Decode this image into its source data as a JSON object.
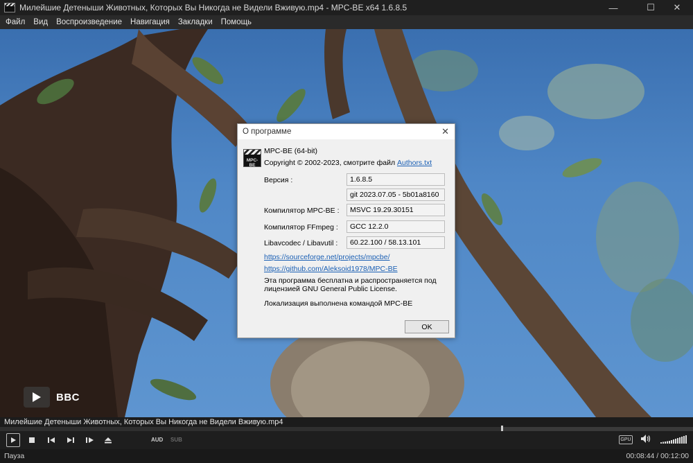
{
  "window": {
    "title": "Милейшие Детеныши Животных, Которых Вы Никогда не Видели Вживую.mp4 - MPC-BE x64 1.6.8.5",
    "min_glyph": "—",
    "max_glyph": "☐",
    "close_glyph": "✕"
  },
  "menu": [
    "Файл",
    "Вид",
    "Воспроизведение",
    "Навигация",
    "Закладки",
    "Помощь"
  ],
  "video": {
    "watermark": "BBC"
  },
  "about_dialog": {
    "title": "О программе",
    "close_glyph": "✕",
    "logo_text": "MPC-BE",
    "app_name": "MPC-BE (64-bit)",
    "copyright_prefix": "Copyright © 2002-2023, смотрите файл",
    "copyright_link": "Authors.txt",
    "rows": [
      {
        "label": "Версия :",
        "value": "1.6.8.5"
      },
      {
        "label": "",
        "value": "git 2023.07.05 - 5b01a8160"
      },
      {
        "label": "Компилятор MPC-BE :",
        "value": "MSVC 19.29.30151"
      },
      {
        "label": "Компилятор FFmpeg :",
        "value": "GCC 12.2.0"
      },
      {
        "label": "Libavcodec / Libavutil :",
        "value": "60.22.100 / 58.13.101"
      }
    ],
    "link1": "https://sourceforge.net/projects/mpcbe/",
    "link2": "https://github.com/Aleksoid1978/MPC-BE",
    "license_text": "Эта программа бесплатна и распространяется под лицензией GNU General Public License.",
    "localization_text": "Локализация выполнена командой MPC-BE",
    "ok_label": "OK"
  },
  "player": {
    "filename": "Милейшие Детеныши Животных, Которых Вы Никогда не Видели Вживую.mp4",
    "progress": 0.7236,
    "aud_label": "AUD",
    "sub_label": "SUB",
    "gpu_label": "GPU",
    "status": "Пауза",
    "time": "00:08:44 / 00:12:00"
  },
  "icons": {
    "play": "play-icon",
    "stop": "stop-icon",
    "prev": "skip-back-icon",
    "next": "skip-forward-icon",
    "frame_step": "frame-step-icon",
    "eject": "eject-icon",
    "volume": "volume-icon"
  }
}
